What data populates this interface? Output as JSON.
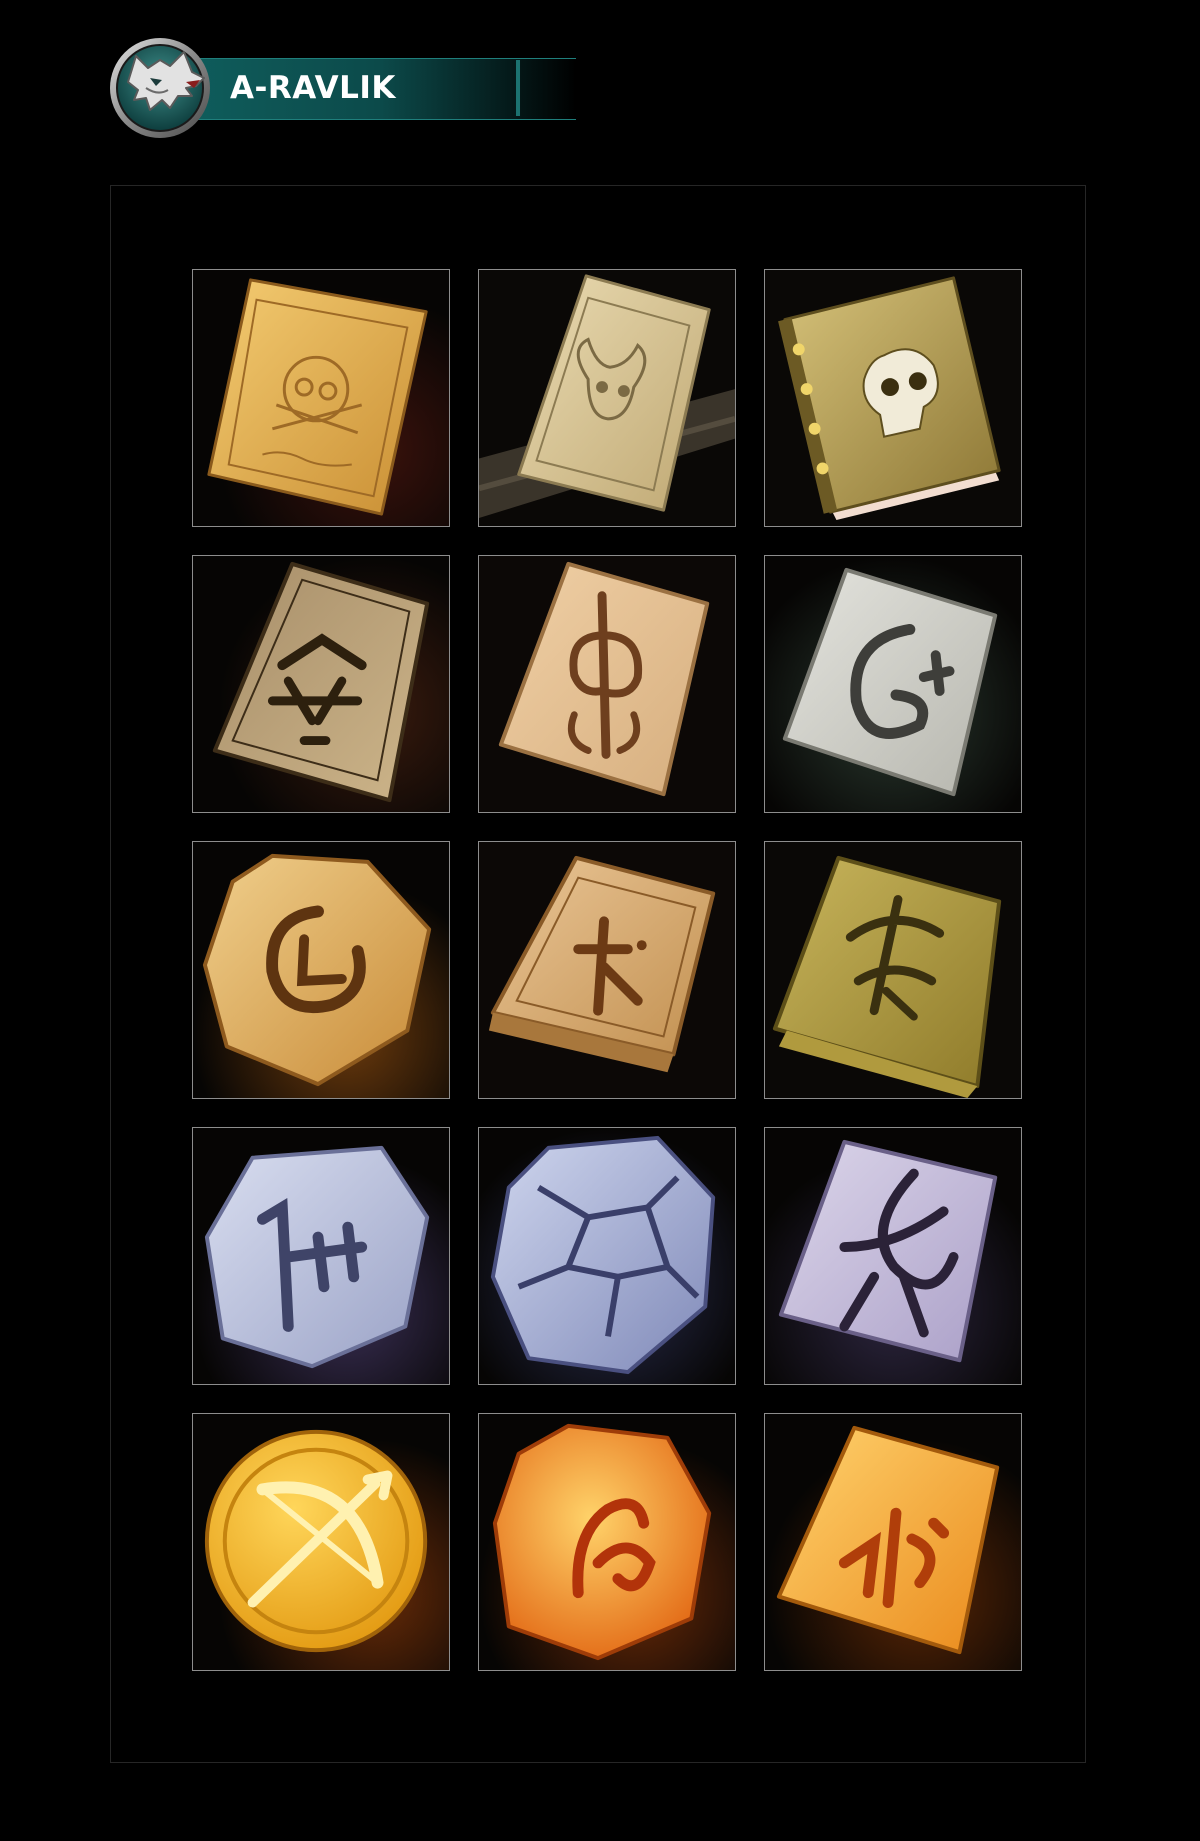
{
  "header": {
    "title": "A-RAVLIK",
    "logo_icon": "wolf-head-emblem-icon",
    "banner_color": "#0f5d5c"
  },
  "gallery": {
    "border_color": "#8d8d8d",
    "items": [
      {
        "icon": "skull-parchment-scroll-icon",
        "color": "#d9a94c"
      },
      {
        "icon": "horned-skull-parchment-scroll-icon",
        "color": "#cdbb8a"
      },
      {
        "icon": "skull-spellbook-icon",
        "color": "#b39a4c"
      },
      {
        "icon": "brown-rune-tablet-icon",
        "color": "#9a8560"
      },
      {
        "icon": "fleur-rune-tablet-icon",
        "color": "#d8b285"
      },
      {
        "icon": "grey-rune-tablet-icon",
        "color": "#c7c7c0"
      },
      {
        "icon": "spiral-rune-stone-icon",
        "color": "#d6ad66"
      },
      {
        "icon": "glyph-rune-tablet-icon",
        "color": "#d3a66a"
      },
      {
        "icon": "olive-rune-slab-icon",
        "color": "#b5a046"
      },
      {
        "icon": "crown-rune-stone-icon",
        "color": "#b6bedc"
      },
      {
        "icon": "cracked-crystal-rune-stone-icon",
        "color": "#9aa6d0"
      },
      {
        "icon": "lavender-rune-tablet-icon",
        "color": "#c4bad8"
      },
      {
        "icon": "golden-bow-coin-icon",
        "color": "#f0b02a"
      },
      {
        "icon": "amber-rune-stone-icon",
        "color": "#f29a1e"
      },
      {
        "icon": "amber-rune-tablet-icon",
        "color": "#f4a932"
      }
    ]
  }
}
